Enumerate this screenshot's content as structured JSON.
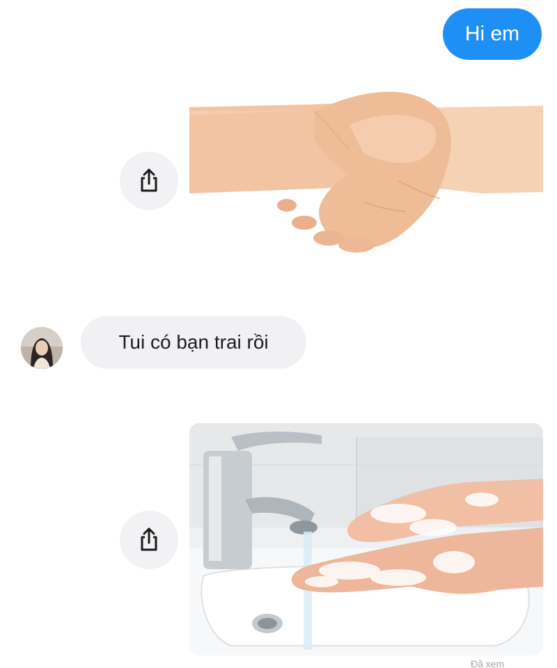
{
  "colors": {
    "outgoing_bubble": "#1e90f5",
    "incoming_bubble": "#f1f1f4",
    "share_button_bg": "#f2f2f5"
  },
  "messages": [
    {
      "direction": "outgoing",
      "type": "text",
      "text": "Hi em"
    },
    {
      "direction": "outgoing",
      "type": "image",
      "image": "handshake-photo",
      "action_icon": "share-icon"
    },
    {
      "direction": "incoming",
      "type": "text",
      "text": "Tui có bạn trai rồi",
      "sender_icon": "avatar-photo"
    },
    {
      "direction": "outgoing",
      "type": "image",
      "image": "handwashing-photo",
      "action_icon": "share-icon"
    }
  ],
  "status": {
    "text": "Đã xem"
  }
}
